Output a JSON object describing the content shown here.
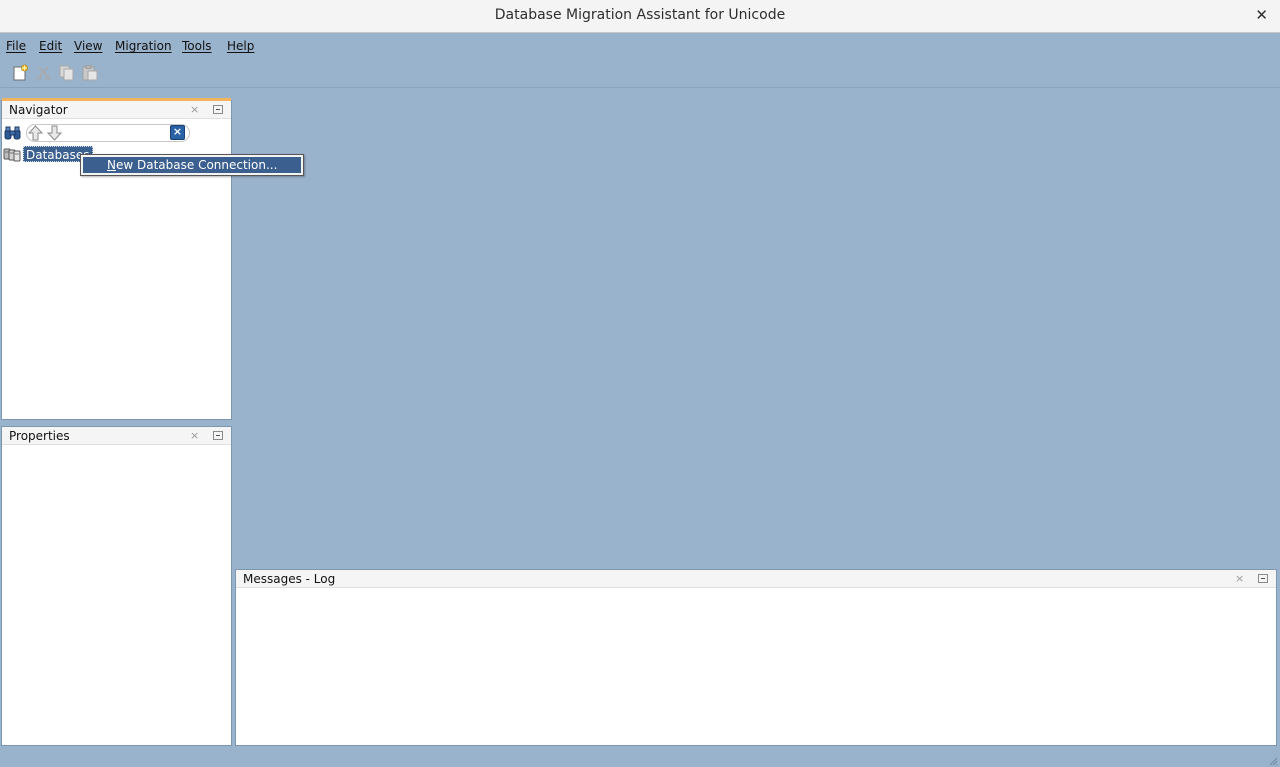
{
  "window": {
    "title": "Database Migration Assistant for Unicode",
    "close_glyph": "✕"
  },
  "menubar": {
    "items": [
      {
        "label": "File"
      },
      {
        "label": "Edit"
      },
      {
        "label": "View"
      },
      {
        "label": "Migration"
      },
      {
        "label": "Tools"
      },
      {
        "label": "Help"
      }
    ]
  },
  "toolbar": {
    "buttons": [
      {
        "icon": "new-file-icon",
        "enabled": true
      },
      {
        "icon": "cut-icon",
        "enabled": false
      },
      {
        "icon": "copy-icon",
        "enabled": false
      },
      {
        "icon": "paste-icon",
        "enabled": false
      }
    ]
  },
  "navigator": {
    "title": "Navigator",
    "close_glyph": "×",
    "search_value": "",
    "tree": [
      {
        "label": "Databases",
        "icon": "database-folder-icon",
        "selected": true
      }
    ]
  },
  "context_menu": {
    "items": [
      {
        "mnemonic": "N",
        "rest": "ew Database Connection...",
        "highlighted": true
      }
    ]
  },
  "properties": {
    "title": "Properties",
    "close_glyph": "×"
  },
  "messages": {
    "title": "Messages - Log",
    "close_glyph": "×"
  },
  "colors": {
    "workspace_bg": "#9ab3cd",
    "selection": "#3b5f8f",
    "navigator_accent": "#f6b35f",
    "titlebar_bg": "#f4f4f4"
  }
}
